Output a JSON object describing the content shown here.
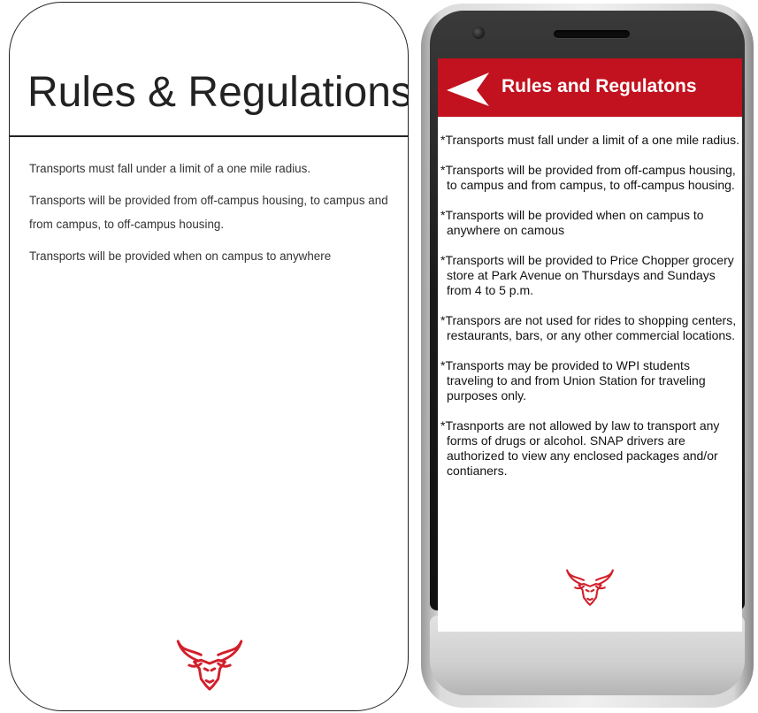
{
  "wireframe": {
    "title": "Rules & Regulations",
    "items": [
      "Transports must fall under a limit of a one mile radius.",
      "Transports will be provided from off-campus housing, to campus and from campus, to off-campus housing.",
      "Transports will be provided when on campus to anywhere"
    ],
    "logo_icon": "goat-logo-icon"
  },
  "phone": {
    "header": {
      "title": "Rules and Regulatons",
      "back_icon": "back-arrow-icon"
    },
    "rules": [
      "*Transports must fall under a limit of a one mile radius.",
      "*Transports will be provided from off-campus housing, to campus and from campus, to off-campus housing.",
      "*Transports will be provided when on campus to anywhere on camous",
      "*Transports will be provided to Price Chopper grocery store at Park Avenue on Thursdays and Sundays from 4 to 5 p.m.",
      "*Transpors are not used for rides to shopping centers, restaurants, bars, or any other commercial locations.",
      "*Transports may be provided to WPI students traveling to and from Union Station for traveling purposes only.",
      "*Trasnports are not allowed by law to transport any forms of drugs or alcohol. SNAP drivers are authorized to view any enclosed packages and/or contianers."
    ],
    "logo_icon": "goat-logo-icon"
  },
  "colors": {
    "brand_red": "#c2121f",
    "screen_bg": "#ffffff",
    "text": "#111111"
  }
}
